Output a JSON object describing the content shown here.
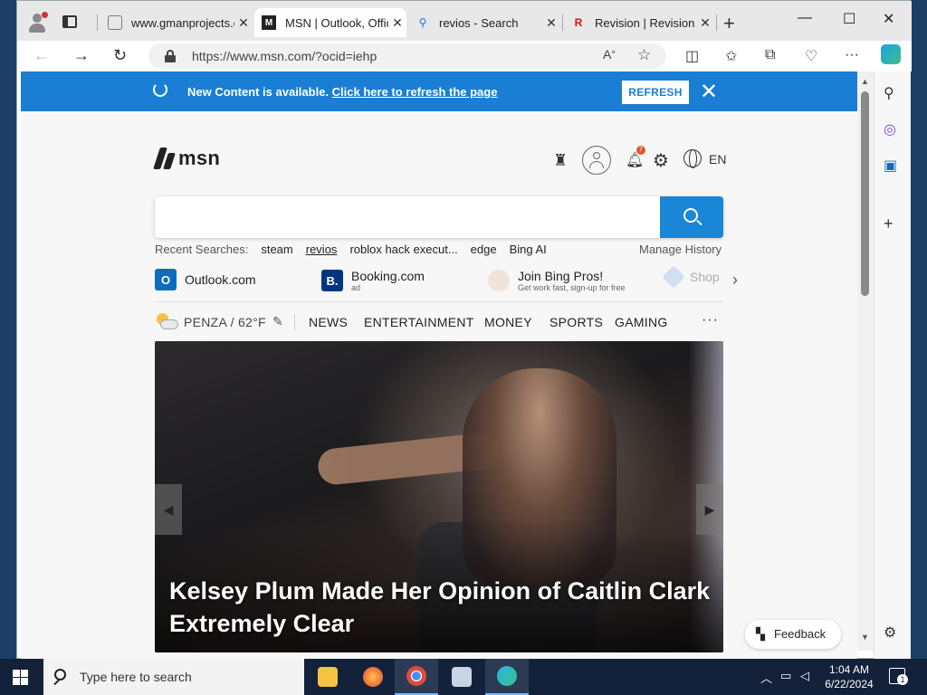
{
  "tabs": [
    {
      "title": "www.gmanprojects.com",
      "favicon": "page-icon",
      "close": "✕"
    },
    {
      "title": "MSN | Outlook, Office",
      "favicon": "msn-icon",
      "close": "✕"
    },
    {
      "title": "revios - Search",
      "favicon": "search-icon",
      "close": "✕"
    },
    {
      "title": "Revision | Revision",
      "favicon": "revision-icon",
      "close": "✕"
    }
  ],
  "address": {
    "url": "https://www.msn.com/?ocid=iehp"
  },
  "banner": {
    "text": "New Content is available.",
    "link": "Click here to refresh the page",
    "button": "REFRESH"
  },
  "header": {
    "logo": "msn",
    "notifications": "7",
    "language": "EN"
  },
  "recent": {
    "label": "Recent Searches:",
    "items": [
      "steam",
      "revios",
      "roblox hack execut...",
      "edge",
      "Bing AI"
    ],
    "manage": "Manage History"
  },
  "quicklinks": [
    {
      "label": "Outlook.com",
      "sub": ""
    },
    {
      "label": "Booking.com",
      "sub": "ad",
      "icon_letter": "B."
    },
    {
      "label": "Join Bing Pros!",
      "sub": "Get work fast, sign-up for free"
    },
    {
      "label": "Shop",
      "sub": ""
    }
  ],
  "weather": {
    "location": "PENZA / 62°F"
  },
  "nav": [
    "NEWS",
    "ENTERTAINMENT",
    "MONEY",
    "SPORTS",
    "GAMING"
  ],
  "hero": {
    "headline": "Kelsey Plum Made Her Opinion of Caitlin Clark Extremely Clear"
  },
  "feedback": {
    "label": "Feedback"
  },
  "taskbar": {
    "search_placeholder": "Type here to search",
    "time": "1:04 AM",
    "date": "6/22/2024",
    "notifications": "1"
  },
  "colors": {
    "banner": "#1a7fd4",
    "search_button": "#1a86d8",
    "taskbar": "#14213a"
  }
}
